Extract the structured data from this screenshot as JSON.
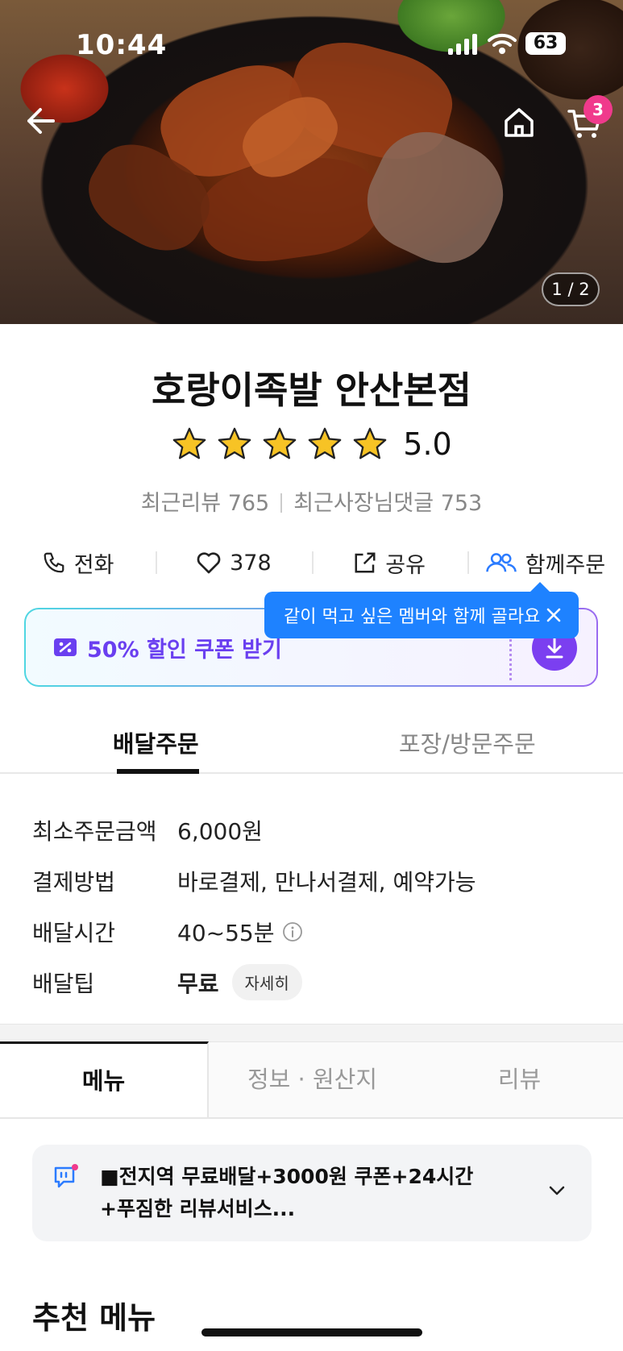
{
  "status": {
    "time": "10:44",
    "battery": "63"
  },
  "hero": {
    "page_indicator": "1 / 2",
    "cart_count": "3"
  },
  "store": {
    "name": "호랑이족발 안산본점",
    "rating": "5.0",
    "stars": 5,
    "recent_reviews": "최근리뷰 765",
    "owner_replies": "최근사장님댓글 753"
  },
  "actions": {
    "call": "전화",
    "likes": "378",
    "share": "공유",
    "group_order": "함께주문"
  },
  "tooltip": {
    "text": "같이 먹고 싶은 멤버와 함께 골라요"
  },
  "coupon": {
    "label": "50% 할인 쿠폰 받기"
  },
  "order_tabs": {
    "delivery": "배달주문",
    "pickup": "포장/방문주문"
  },
  "info": [
    {
      "label": "최소주문금액",
      "value": "6,000원"
    },
    {
      "label": "결제방법",
      "value": "바로결제, 만나서결제, 예약가능"
    },
    {
      "label": "배달시간",
      "value": "40~55분"
    },
    {
      "label": "배달팁",
      "value": "무료",
      "chip": "자세히"
    }
  ],
  "menu_tabs": {
    "menu": "메뉴",
    "info": "정보 · 원산지",
    "review": "리뷰"
  },
  "notice": {
    "line1": "■전지역 무료배달+3000원 쿠폰+24시간",
    "line2": "+푸짐한 리뷰서비스..."
  },
  "section": {
    "recommended": "추천 메뉴"
  },
  "colors": {
    "accent": "#1e82ff",
    "coupon": "#7b3ff0",
    "badge": "#f03a8c",
    "star": "#f7c325"
  }
}
